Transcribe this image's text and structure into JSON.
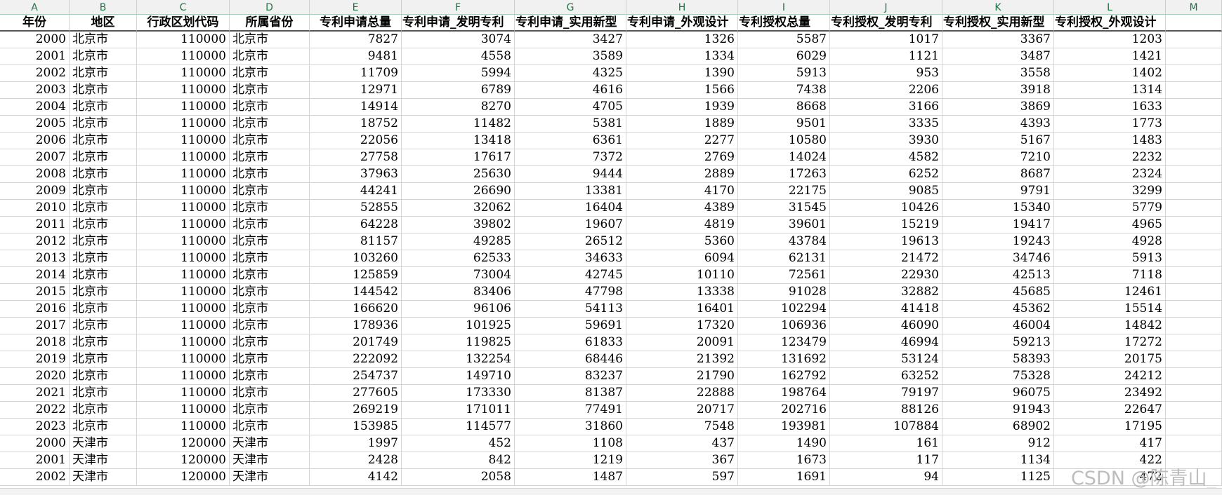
{
  "column_letters": [
    "A",
    "B",
    "C",
    "D",
    "E",
    "F",
    "G",
    "H",
    "I",
    "J",
    "K",
    "L",
    "M"
  ],
  "headers": [
    "年份",
    "地区",
    "行政区划代码",
    "所属省份",
    "专利申请总量",
    "专利申请_发明专利",
    "专利申请_实用新型",
    "专利申请_外观设计",
    "专利授权总量",
    "专利授权_发明专利",
    "专利授权_实用新型",
    "专利授权_外观设计"
  ],
  "rows": [
    [
      "2000",
      "北京市",
      "110000",
      "北京市",
      "7827",
      "3074",
      "3427",
      "1326",
      "5587",
      "1017",
      "3367",
      "1203"
    ],
    [
      "2001",
      "北京市",
      "110000",
      "北京市",
      "9481",
      "4558",
      "3589",
      "1334",
      "6029",
      "1121",
      "3487",
      "1421"
    ],
    [
      "2002",
      "北京市",
      "110000",
      "北京市",
      "11709",
      "5994",
      "4325",
      "1390",
      "5913",
      "953",
      "3558",
      "1402"
    ],
    [
      "2003",
      "北京市",
      "110000",
      "北京市",
      "12971",
      "6789",
      "4616",
      "1566",
      "7438",
      "2206",
      "3918",
      "1314"
    ],
    [
      "2004",
      "北京市",
      "110000",
      "北京市",
      "14914",
      "8270",
      "4705",
      "1939",
      "8668",
      "3166",
      "3869",
      "1633"
    ],
    [
      "2005",
      "北京市",
      "110000",
      "北京市",
      "18752",
      "11482",
      "5381",
      "1889",
      "9501",
      "3335",
      "4393",
      "1773"
    ],
    [
      "2006",
      "北京市",
      "110000",
      "北京市",
      "22056",
      "13418",
      "6361",
      "2277",
      "10580",
      "3930",
      "5167",
      "1483"
    ],
    [
      "2007",
      "北京市",
      "110000",
      "北京市",
      "27758",
      "17617",
      "7372",
      "2769",
      "14024",
      "4582",
      "7210",
      "2232"
    ],
    [
      "2008",
      "北京市",
      "110000",
      "北京市",
      "37963",
      "25630",
      "9444",
      "2889",
      "17263",
      "6252",
      "8687",
      "2324"
    ],
    [
      "2009",
      "北京市",
      "110000",
      "北京市",
      "44241",
      "26690",
      "13381",
      "4170",
      "22175",
      "9085",
      "9791",
      "3299"
    ],
    [
      "2010",
      "北京市",
      "110000",
      "北京市",
      "52855",
      "32062",
      "16404",
      "4389",
      "31545",
      "10426",
      "15340",
      "5779"
    ],
    [
      "2011",
      "北京市",
      "110000",
      "北京市",
      "64228",
      "39802",
      "19607",
      "4819",
      "39601",
      "15219",
      "19417",
      "4965"
    ],
    [
      "2012",
      "北京市",
      "110000",
      "北京市",
      "81157",
      "49285",
      "26512",
      "5360",
      "43784",
      "19613",
      "19243",
      "4928"
    ],
    [
      "2013",
      "北京市",
      "110000",
      "北京市",
      "103260",
      "62533",
      "34633",
      "6094",
      "62131",
      "21472",
      "34746",
      "5913"
    ],
    [
      "2014",
      "北京市",
      "110000",
      "北京市",
      "125859",
      "73004",
      "42745",
      "10110",
      "72561",
      "22930",
      "42513",
      "7118"
    ],
    [
      "2015",
      "北京市",
      "110000",
      "北京市",
      "144542",
      "83406",
      "47798",
      "13338",
      "91028",
      "32882",
      "45685",
      "12461"
    ],
    [
      "2016",
      "北京市",
      "110000",
      "北京市",
      "166620",
      "96106",
      "54113",
      "16401",
      "102294",
      "41418",
      "45362",
      "15514"
    ],
    [
      "2017",
      "北京市",
      "110000",
      "北京市",
      "178936",
      "101925",
      "59691",
      "17320",
      "106936",
      "46090",
      "46004",
      "14842"
    ],
    [
      "2018",
      "北京市",
      "110000",
      "北京市",
      "201749",
      "119825",
      "61833",
      "20091",
      "123479",
      "46994",
      "59213",
      "17272"
    ],
    [
      "2019",
      "北京市",
      "110000",
      "北京市",
      "222092",
      "132254",
      "68446",
      "21392",
      "131692",
      "53124",
      "58393",
      "20175"
    ],
    [
      "2020",
      "北京市",
      "110000",
      "北京市",
      "254737",
      "149710",
      "83237",
      "21790",
      "162792",
      "63252",
      "75328",
      "24212"
    ],
    [
      "2021",
      "北京市",
      "110000",
      "北京市",
      "277605",
      "173330",
      "81387",
      "22888",
      "198764",
      "79197",
      "96075",
      "23492"
    ],
    [
      "2022",
      "北京市",
      "110000",
      "北京市",
      "269219",
      "171011",
      "77491",
      "20717",
      "202716",
      "88126",
      "91943",
      "22647"
    ],
    [
      "2023",
      "北京市",
      "110000",
      "北京市",
      "153985",
      "114577",
      "31860",
      "7548",
      "193981",
      "107884",
      "68902",
      "17195"
    ],
    [
      "2000",
      "天津市",
      "120000",
      "天津市",
      "1997",
      "452",
      "1108",
      "437",
      "1490",
      "161",
      "912",
      "417"
    ],
    [
      "2001",
      "天津市",
      "120000",
      "天津市",
      "2428",
      "842",
      "1219",
      "367",
      "1673",
      "117",
      "1134",
      "422"
    ],
    [
      "2002",
      "天津市",
      "120000",
      "天津市",
      "4142",
      "2058",
      "1487",
      "597",
      "1691",
      "94",
      "1125",
      "472"
    ]
  ],
  "watermark": "CSDN @陈青山_"
}
